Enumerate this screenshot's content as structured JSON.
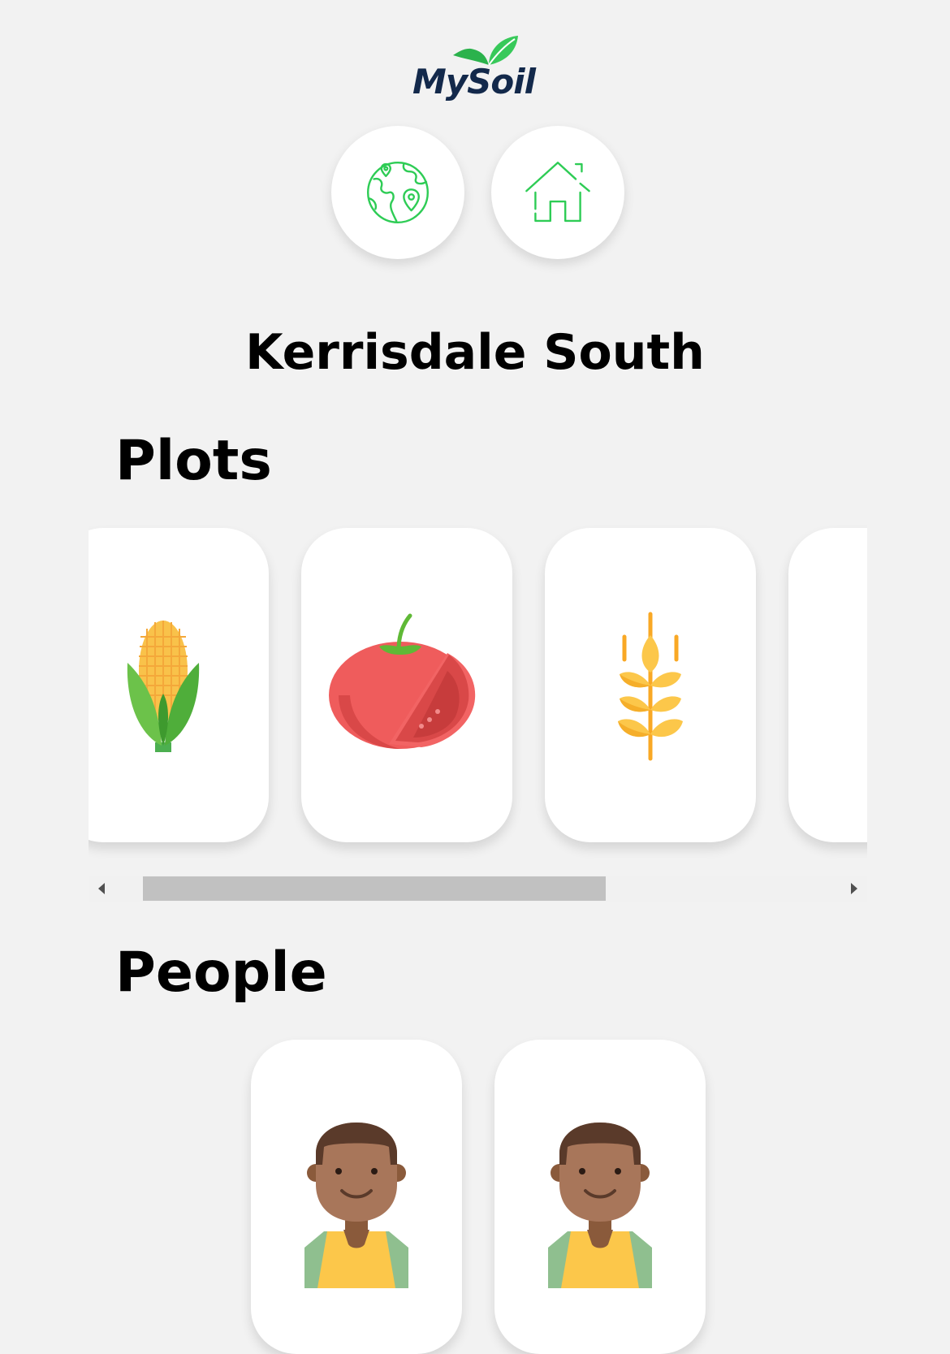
{
  "app": {
    "logo_text": "MySoil"
  },
  "nav": {
    "buttons": [
      {
        "icon": "globe-location-icon"
      },
      {
        "icon": "house-icon"
      }
    ]
  },
  "community": {
    "title": "Kerrisdale South"
  },
  "plots": {
    "heading": "Plots",
    "items": [
      {
        "icon": "corn-icon"
      },
      {
        "icon": "tomato-icon"
      },
      {
        "icon": "wheat-icon"
      },
      {
        "icon": "partial-plot-icon"
      }
    ],
    "scroll_position": 0.07
  },
  "people": {
    "heading": "People",
    "items": [
      {
        "icon": "person-avatar-icon"
      },
      {
        "icon": "person-avatar-icon"
      }
    ]
  },
  "colors": {
    "background": "#f2f2f2",
    "accent_green": "#2ecc55",
    "logo_navy": "#13294b",
    "card": "#ffffff"
  }
}
